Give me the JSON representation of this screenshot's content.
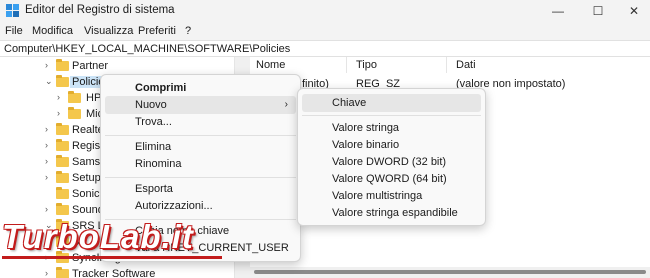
{
  "window": {
    "title": "Editor del Registro di sistema",
    "minimize_glyph": "—",
    "maximize_glyph": "☐",
    "close_glyph": "✕"
  },
  "menubar": {
    "items": [
      "File",
      "Modifica",
      "Visualizza",
      "Preferiti",
      "?"
    ]
  },
  "address": {
    "path": "Computer\\HKEY_LOCAL_MACHINE\\SOFTWARE\\Policies"
  },
  "tree": {
    "items": [
      {
        "label": "Partner",
        "expanded": false
      },
      {
        "label": "Policies",
        "expanded": true,
        "selected": true
      },
      {
        "label": "HP",
        "expanded": false
      },
      {
        "label": "Micr",
        "expanded": false
      },
      {
        "label": "Realtek",
        "expanded": false
      },
      {
        "label": "Registe",
        "expanded": false
      },
      {
        "label": "Samsu",
        "expanded": false
      },
      {
        "label": "Setup",
        "expanded": false
      },
      {
        "label": "SonicFo",
        "expanded": false
      },
      {
        "label": "SoundR",
        "expanded": false
      },
      {
        "label": "SRS Lab",
        "expanded": true
      },
      {
        "label": "SS",
        "expanded": false
      },
      {
        "label": "SyncIntegrationClients",
        "expanded": false
      },
      {
        "label": "Tracker Software",
        "expanded": false
      }
    ]
  },
  "list": {
    "columns": [
      "Nome",
      "Tipo",
      "Dati"
    ],
    "rows": [
      {
        "name": "(Predefinito)",
        "name_visible": "finito)",
        "type": "REG_SZ",
        "data": "(valore non impostato)"
      }
    ]
  },
  "context_menu": {
    "items": [
      {
        "label": "Comprimi",
        "bold": true
      },
      {
        "label": "Nuovo",
        "submenu": true,
        "hover": true
      },
      {
        "label": "Trova..."
      },
      {
        "label": "Elimina"
      },
      {
        "label": "Rinomina"
      },
      {
        "label": "Esporta"
      },
      {
        "label": "Autorizzazioni..."
      },
      {
        "label": "Copia nome chiave"
      },
      {
        "label": "Vai a HKEY_CURRENT_USER"
      }
    ],
    "submenu_arrow": "›"
  },
  "submenu": {
    "items": [
      {
        "label": "Chiave",
        "hover": true
      },
      {
        "label": "Valore stringa"
      },
      {
        "label": "Valore binario"
      },
      {
        "label": "Valore DWORD (32 bit)"
      },
      {
        "label": "Valore QWORD (64 bit)"
      },
      {
        "label": "Valore multistringa"
      },
      {
        "label": "Valore stringa espandibile"
      }
    ]
  },
  "watermark": {
    "text": "TurboLab.it"
  },
  "colors": {
    "accent": "#0067c0",
    "folder": "#f4c74c",
    "selection": "#cce4f7",
    "watermark": "#c21c1c"
  }
}
